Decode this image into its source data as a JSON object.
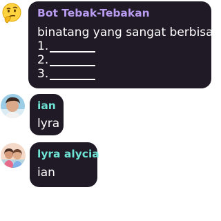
{
  "messages": [
    {
      "sender": "Bot Tebak-Tebakan",
      "sender_color": "#b99cf0",
      "avatar_icon": "thinking-face-emoji-icon",
      "lines": [
        "binatang yang sangat berbisa?",
        "1.",
        "2.",
        "3."
      ]
    },
    {
      "sender": "ian",
      "sender_color": "#6fe3d4",
      "avatar_icon": "user-photo-avatar",
      "lines": [
        "lyra"
      ]
    },
    {
      "sender": "lyra alycia",
      "sender_color": "#6fe3d4",
      "avatar_icon": "user-photo-avatar",
      "lines": [
        "ian"
      ]
    }
  ],
  "colors": {
    "bubble_background": "#1f1a26",
    "message_text": "#ffffff",
    "page_background": "#ffffff"
  }
}
